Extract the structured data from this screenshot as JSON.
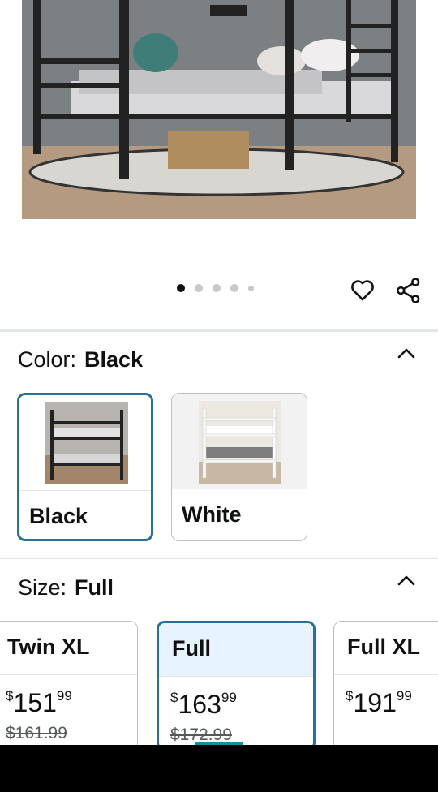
{
  "gallery": {
    "image_count": 5,
    "active_index": 0,
    "icons": {
      "favorite": "heart-outline-icon",
      "share": "share-icon"
    }
  },
  "color_selector": {
    "label": "Color:",
    "selected_value": "Black",
    "collapse_icon": "chevron-up-icon",
    "options": [
      {
        "label": "Black",
        "selected": true
      },
      {
        "label": "White",
        "selected": false
      }
    ]
  },
  "size_selector": {
    "label": "Size:",
    "selected_value": "Full",
    "collapse_icon": "chevron-up-icon",
    "options": [
      {
        "name": "Twin XL",
        "currency": "$",
        "price_whole": "151",
        "price_fraction": "99",
        "list_price": "$161.99",
        "selected": false
      },
      {
        "name": "Full",
        "currency": "$",
        "price_whole": "163",
        "price_fraction": "99",
        "list_price": "$172.99",
        "selected": true
      },
      {
        "name": "Full XL",
        "currency": "$",
        "price_whole": "191",
        "price_fraction": "99",
        "list_price": "",
        "selected": false
      }
    ]
  },
  "colors": {
    "accent_border": "#2a6f97",
    "selected_bg": "#e8f4fd",
    "scroll_indicator": "#0f8fa8"
  }
}
